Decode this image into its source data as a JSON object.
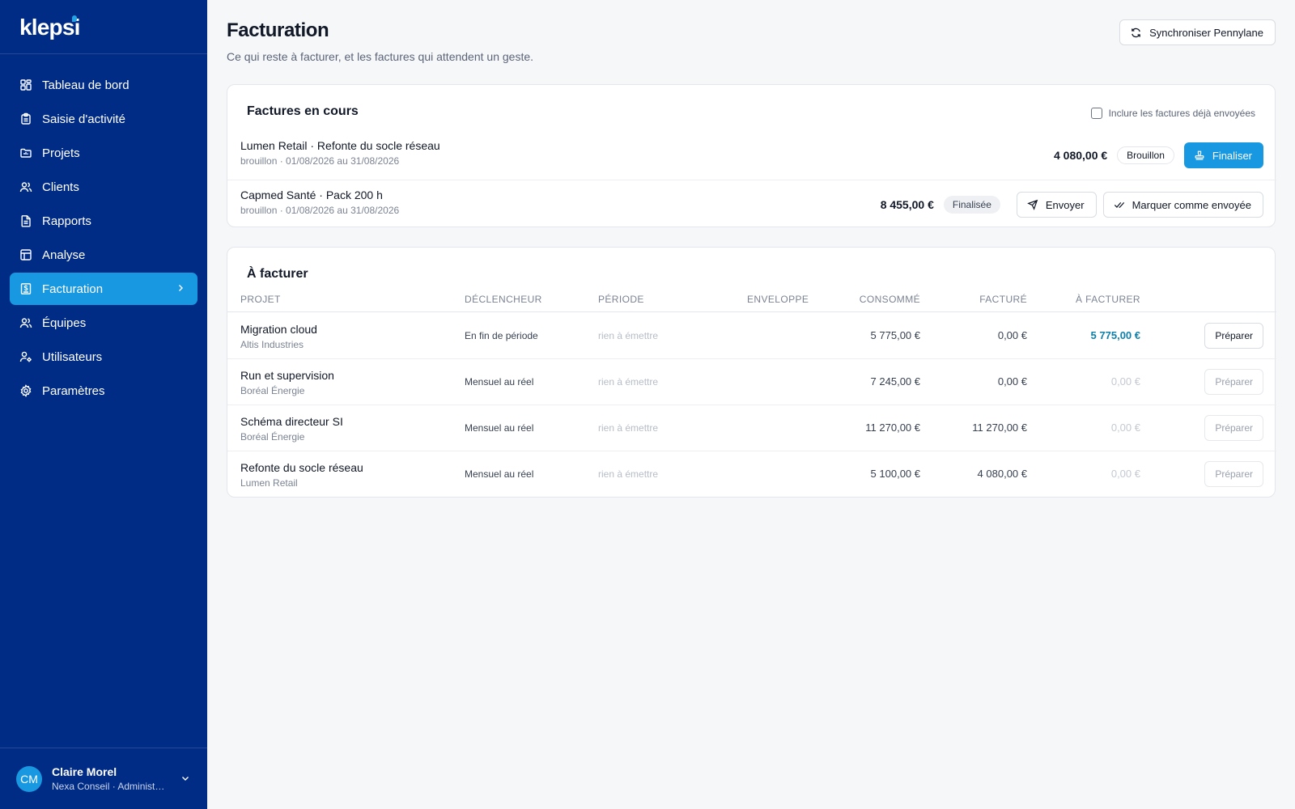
{
  "app": {
    "brand": "klepsi"
  },
  "sidebar": {
    "items": [
      {
        "label": "Tableau de bord",
        "icon": "dashboard-icon"
      },
      {
        "label": "Saisie d'activité",
        "icon": "clipboard-icon"
      },
      {
        "label": "Projets",
        "icon": "folder-icon"
      },
      {
        "label": "Clients",
        "icon": "users-icon"
      },
      {
        "label": "Rapports",
        "icon": "document-icon"
      },
      {
        "label": "Analyse",
        "icon": "table-icon"
      },
      {
        "label": "Facturation",
        "icon": "invoice-icon",
        "active": true
      },
      {
        "label": "Équipes",
        "icon": "team-icon"
      },
      {
        "label": "Utilisateurs",
        "icon": "user-cog-icon"
      },
      {
        "label": "Paramètres",
        "icon": "gear-icon"
      }
    ]
  },
  "user": {
    "initials": "CM",
    "name": "Claire Morel",
    "org": "Nexa Conseil · Administrateur"
  },
  "header": {
    "title": "Facturation",
    "subtitle": "Ce qui reste à facturer, et les factures qui attendent un geste.",
    "sync_label": "Synchroniser Pennylane"
  },
  "current_invoices": {
    "title": "Factures en cours",
    "include_label": "Inclure les factures déjà envoyées",
    "include_checked": false,
    "rows": [
      {
        "title": "Lumen Retail · Refonte du socle réseau",
        "meta": "brouillon · 01/08/2026 au 31/08/2026",
        "amount": "4 080,00 €",
        "status": "Brouillon",
        "primary_action": "Finaliser"
      },
      {
        "title": "Capmed Santé · Pack 200 h",
        "meta": "brouillon · 01/08/2026 au 31/08/2026",
        "amount": "8 455,00 €",
        "status": "Finalisée",
        "send_action": "Envoyer",
        "mark_action": "Marquer comme envoyée"
      }
    ]
  },
  "to_invoice": {
    "title": "À facturer",
    "columns": {
      "project": "Projet",
      "trigger": "Déclencheur",
      "period": "Période",
      "envelope": "Enveloppe",
      "consumed": "Consommé",
      "invoiced": "Facturé",
      "to_invoice": "À facturer"
    },
    "rows": [
      {
        "project": "Migration cloud",
        "client": "Altis Industries",
        "trigger": "En fin de période",
        "period": "rien à émettre",
        "consumed": "5 775,00 €",
        "invoiced": "0,00 €",
        "to_invoice": "5 775,00 €",
        "action": "Préparer",
        "enabled": true
      },
      {
        "project": "Run et supervision",
        "client": "Boréal Énergie",
        "trigger": "Mensuel au réel",
        "period": "rien à émettre",
        "consumed": "7 245,00 €",
        "invoiced": "0,00 €",
        "to_invoice": "0,00 €",
        "action": "Préparer",
        "enabled": false
      },
      {
        "project": "Schéma directeur SI",
        "client": "Boréal Énergie",
        "trigger": "Mensuel au réel",
        "period": "rien à émettre",
        "consumed": "11 270,00 €",
        "invoiced": "11 270,00 €",
        "to_invoice": "0,00 €",
        "action": "Préparer",
        "enabled": false
      },
      {
        "project": "Refonte du socle réseau",
        "client": "Lumen Retail",
        "trigger": "Mensuel au réel",
        "period": "rien à émettre",
        "consumed": "5 100,00 €",
        "invoiced": "4 080,00 €",
        "to_invoice": "0,00 €",
        "action": "Préparer",
        "enabled": false
      }
    ]
  },
  "colors": {
    "sidebar": "#012c85",
    "accent": "#1798e0",
    "highlight_amount": "#0e7fa8"
  }
}
